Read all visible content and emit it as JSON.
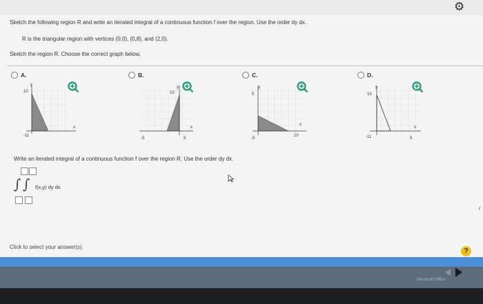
{
  "question": {
    "instruction": "Sketch the following region R and write an iterated integral of a continuous function f over the region. Use the order dy dx.",
    "region_desc": "R is the triangular region with vertices (0,0), (0,8), and (2,0).",
    "sketch_prompt": "Sketch the region R. Choose the correct graph below."
  },
  "options": [
    {
      "letter": "A.",
      "y_top": "10",
      "x_neg": "-11",
      "x_pos": "",
      "axis_y": "y",
      "axis_x": "x"
    },
    {
      "letter": "B.",
      "y_top": "10",
      "x_neg": "-5",
      "x_pos": "5",
      "axis_y": "y",
      "axis_x": "x"
    },
    {
      "letter": "C.",
      "y_top": "5",
      "x_neg": "-5",
      "x_pos": "10",
      "axis_y": "y",
      "axis_x": "x"
    },
    {
      "letter": "D.",
      "y_top": "10",
      "x_neg": "-11",
      "x_pos": "5",
      "axis_y": "y",
      "axis_x": "x"
    }
  ],
  "integral_prompt": "Write an iterated integral of a continuous function f over the region R. Use the order dy dx.",
  "integrand": "f(x,y) dy dx",
  "click_hint": "Click to select your answer(s).",
  "help_label": "?",
  "footer_brand": "Microsoft Office",
  "right_mark": "r",
  "colors": {
    "region_fill": "#8a8a8a",
    "grid": "#d9dfe8",
    "magnifier": "#2a9c7e"
  }
}
